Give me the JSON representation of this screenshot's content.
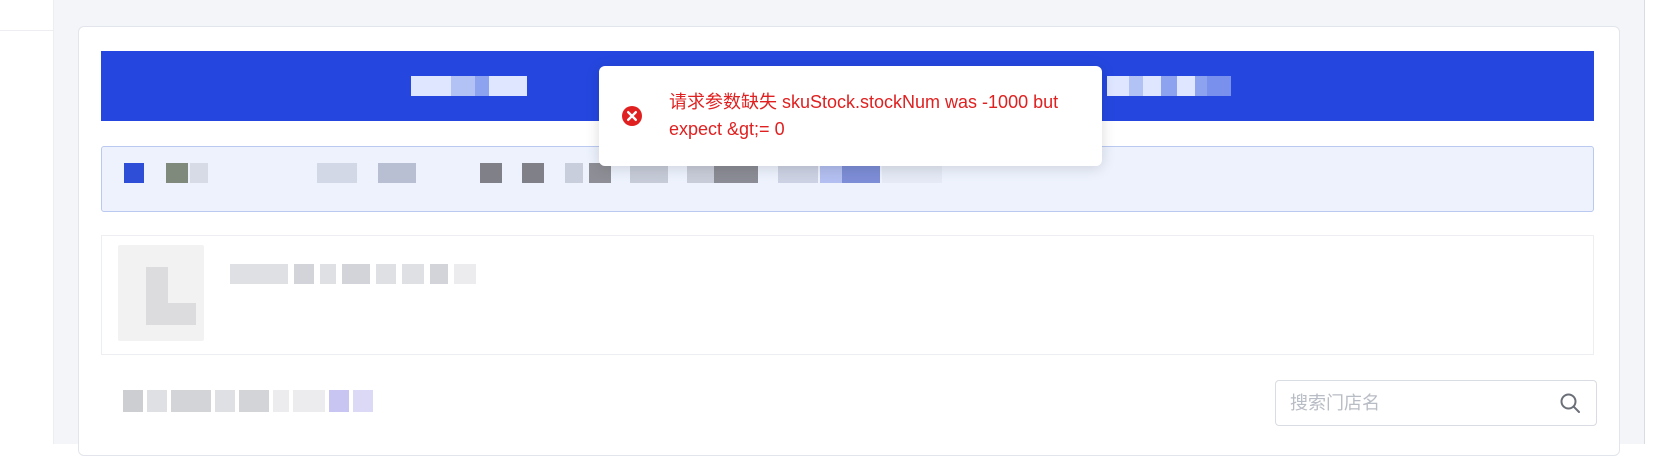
{
  "toast": {
    "type": "error",
    "icon": "error-circle-icon",
    "message": "请求参数缺失 skuStock.stockNum was -1000 but expect &gt;= 0",
    "color": "#e02020"
  },
  "tab_bar": {
    "color": "#2547df"
  },
  "search": {
    "placeholder": "搜索门店名",
    "value": "",
    "icon": "search-icon"
  },
  "colors": {
    "page_background": "#f4f5f8",
    "info_bar_background": "#edf2fd",
    "info_bar_border": "#b9c9ef"
  }
}
